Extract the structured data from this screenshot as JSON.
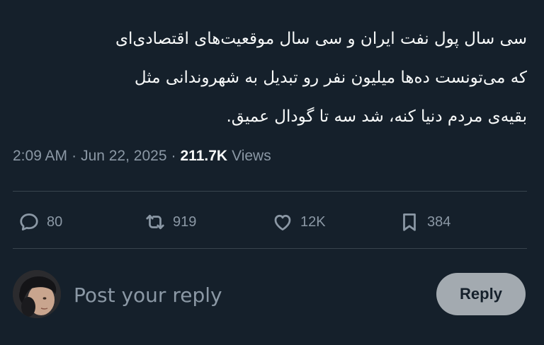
{
  "tweet": {
    "lines": [
      "سی سال پول نفت ایران و سی سال موقعیت‌های اقتصادی‌ای",
      "که می‌تونست ده‌ها میلیون نفر رو تبدیل به شهروندانی مثل",
      "بقیه‌ی مردم دنیا کنه، شد سه تا گودال عمیق."
    ],
    "time": "2:09 AM",
    "date": "Jun 22, 2025",
    "separator": "·",
    "views_count": "211.7K",
    "views_label": "Views"
  },
  "actions": {
    "reply": {
      "icon": "reply-bubble-icon",
      "count": "80"
    },
    "retweet": {
      "icon": "retweet-icon",
      "count": "919"
    },
    "like": {
      "icon": "heart-icon",
      "count": "12K"
    },
    "bookmark": {
      "icon": "bookmark-icon",
      "count": "384"
    }
  },
  "composer": {
    "placeholder": "Post your reply",
    "button_label": "Reply"
  },
  "colors": {
    "background": "#15202b",
    "text": "#f7f9f9",
    "muted": "#8b98a5",
    "divider": "#38444d",
    "button_bg": "#a3aab0"
  }
}
